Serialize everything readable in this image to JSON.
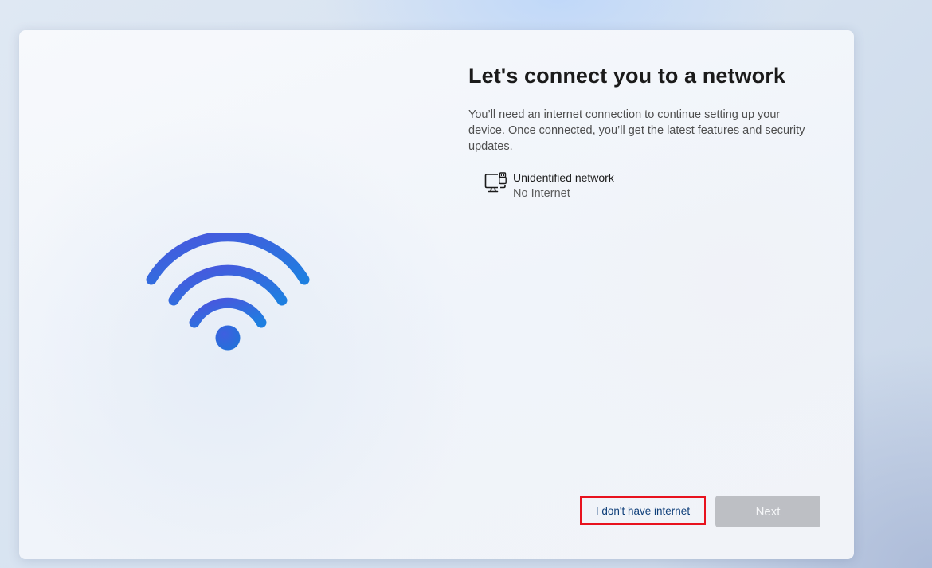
{
  "page": {
    "title": "Let's connect you to a network",
    "description": "You’ll need an internet connection to continue setting up your device. Once connected, you’ll get the latest features and security updates."
  },
  "network": {
    "icon": "ethernet-pc-icon",
    "name": "Unidentified network",
    "status": "No Internet"
  },
  "illustration": {
    "icon": "wifi-icon",
    "gradient_start": "#4b55dd",
    "gradient_end": "#1e7fe0"
  },
  "buttons": {
    "no_internet_label": "I don't have internet",
    "next_label": "Next",
    "next_enabled": false,
    "highlight_color": "#e8121e"
  }
}
